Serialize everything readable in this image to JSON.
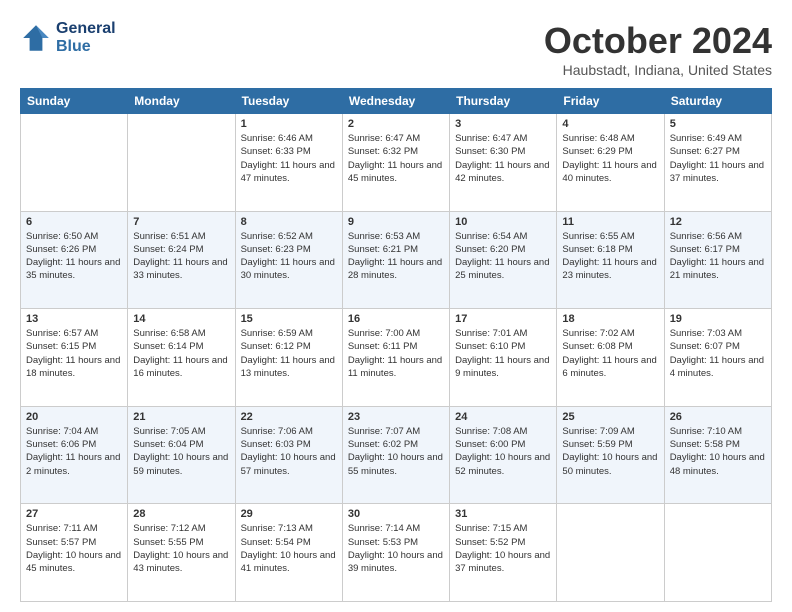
{
  "header": {
    "logo_line1": "General",
    "logo_line2": "Blue",
    "month": "October 2024",
    "location": "Haubstadt, Indiana, United States"
  },
  "days_of_week": [
    "Sunday",
    "Monday",
    "Tuesday",
    "Wednesday",
    "Thursday",
    "Friday",
    "Saturday"
  ],
  "weeks": [
    [
      {
        "day": "",
        "info": ""
      },
      {
        "day": "",
        "info": ""
      },
      {
        "day": "1",
        "info": "Sunrise: 6:46 AM\nSunset: 6:33 PM\nDaylight: 11 hours and 47 minutes."
      },
      {
        "day": "2",
        "info": "Sunrise: 6:47 AM\nSunset: 6:32 PM\nDaylight: 11 hours and 45 minutes."
      },
      {
        "day": "3",
        "info": "Sunrise: 6:47 AM\nSunset: 6:30 PM\nDaylight: 11 hours and 42 minutes."
      },
      {
        "day": "4",
        "info": "Sunrise: 6:48 AM\nSunset: 6:29 PM\nDaylight: 11 hours and 40 minutes."
      },
      {
        "day": "5",
        "info": "Sunrise: 6:49 AM\nSunset: 6:27 PM\nDaylight: 11 hours and 37 minutes."
      }
    ],
    [
      {
        "day": "6",
        "info": "Sunrise: 6:50 AM\nSunset: 6:26 PM\nDaylight: 11 hours and 35 minutes."
      },
      {
        "day": "7",
        "info": "Sunrise: 6:51 AM\nSunset: 6:24 PM\nDaylight: 11 hours and 33 minutes."
      },
      {
        "day": "8",
        "info": "Sunrise: 6:52 AM\nSunset: 6:23 PM\nDaylight: 11 hours and 30 minutes."
      },
      {
        "day": "9",
        "info": "Sunrise: 6:53 AM\nSunset: 6:21 PM\nDaylight: 11 hours and 28 minutes."
      },
      {
        "day": "10",
        "info": "Sunrise: 6:54 AM\nSunset: 6:20 PM\nDaylight: 11 hours and 25 minutes."
      },
      {
        "day": "11",
        "info": "Sunrise: 6:55 AM\nSunset: 6:18 PM\nDaylight: 11 hours and 23 minutes."
      },
      {
        "day": "12",
        "info": "Sunrise: 6:56 AM\nSunset: 6:17 PM\nDaylight: 11 hours and 21 minutes."
      }
    ],
    [
      {
        "day": "13",
        "info": "Sunrise: 6:57 AM\nSunset: 6:15 PM\nDaylight: 11 hours and 18 minutes."
      },
      {
        "day": "14",
        "info": "Sunrise: 6:58 AM\nSunset: 6:14 PM\nDaylight: 11 hours and 16 minutes."
      },
      {
        "day": "15",
        "info": "Sunrise: 6:59 AM\nSunset: 6:12 PM\nDaylight: 11 hours and 13 minutes."
      },
      {
        "day": "16",
        "info": "Sunrise: 7:00 AM\nSunset: 6:11 PM\nDaylight: 11 hours and 11 minutes."
      },
      {
        "day": "17",
        "info": "Sunrise: 7:01 AM\nSunset: 6:10 PM\nDaylight: 11 hours and 9 minutes."
      },
      {
        "day": "18",
        "info": "Sunrise: 7:02 AM\nSunset: 6:08 PM\nDaylight: 11 hours and 6 minutes."
      },
      {
        "day": "19",
        "info": "Sunrise: 7:03 AM\nSunset: 6:07 PM\nDaylight: 11 hours and 4 minutes."
      }
    ],
    [
      {
        "day": "20",
        "info": "Sunrise: 7:04 AM\nSunset: 6:06 PM\nDaylight: 11 hours and 2 minutes."
      },
      {
        "day": "21",
        "info": "Sunrise: 7:05 AM\nSunset: 6:04 PM\nDaylight: 10 hours and 59 minutes."
      },
      {
        "day": "22",
        "info": "Sunrise: 7:06 AM\nSunset: 6:03 PM\nDaylight: 10 hours and 57 minutes."
      },
      {
        "day": "23",
        "info": "Sunrise: 7:07 AM\nSunset: 6:02 PM\nDaylight: 10 hours and 55 minutes."
      },
      {
        "day": "24",
        "info": "Sunrise: 7:08 AM\nSunset: 6:00 PM\nDaylight: 10 hours and 52 minutes."
      },
      {
        "day": "25",
        "info": "Sunrise: 7:09 AM\nSunset: 5:59 PM\nDaylight: 10 hours and 50 minutes."
      },
      {
        "day": "26",
        "info": "Sunrise: 7:10 AM\nSunset: 5:58 PM\nDaylight: 10 hours and 48 minutes."
      }
    ],
    [
      {
        "day": "27",
        "info": "Sunrise: 7:11 AM\nSunset: 5:57 PM\nDaylight: 10 hours and 45 minutes."
      },
      {
        "day": "28",
        "info": "Sunrise: 7:12 AM\nSunset: 5:55 PM\nDaylight: 10 hours and 43 minutes."
      },
      {
        "day": "29",
        "info": "Sunrise: 7:13 AM\nSunset: 5:54 PM\nDaylight: 10 hours and 41 minutes."
      },
      {
        "day": "30",
        "info": "Sunrise: 7:14 AM\nSunset: 5:53 PM\nDaylight: 10 hours and 39 minutes."
      },
      {
        "day": "31",
        "info": "Sunrise: 7:15 AM\nSunset: 5:52 PM\nDaylight: 10 hours and 37 minutes."
      },
      {
        "day": "",
        "info": ""
      },
      {
        "day": "",
        "info": ""
      }
    ]
  ]
}
